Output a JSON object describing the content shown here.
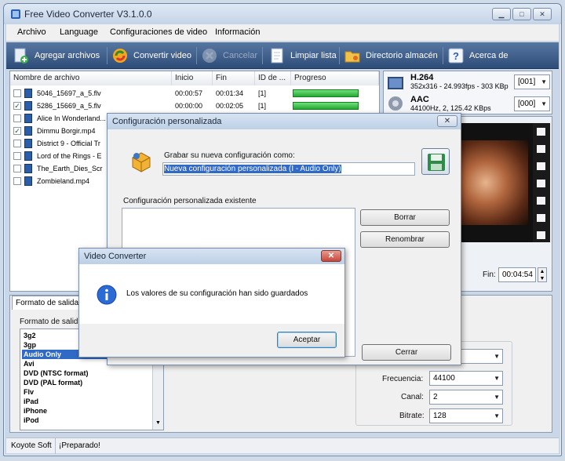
{
  "window": {
    "title": "Free Video Converter V3.1.0.0",
    "caption_buttons": [
      "minimize-icon",
      "maximize-icon",
      "close-icon"
    ]
  },
  "menu": {
    "items": [
      "Archivo",
      "Language",
      "Configuraciones de video",
      "Información"
    ]
  },
  "toolbar": {
    "buttons": [
      {
        "label": "Agregar archivos",
        "icon": "add-file-icon"
      },
      {
        "label": "Convertir video",
        "icon": "convert-icon"
      },
      {
        "label": "Cancelar",
        "icon": "cancel-icon"
      },
      {
        "label": "Limpiar lista",
        "icon": "clear-list-icon"
      },
      {
        "label": "Directorio almacén",
        "icon": "folder-icon"
      },
      {
        "label": "Acerca de",
        "icon": "help-icon"
      }
    ]
  },
  "file_table": {
    "columns": [
      "Nombre de archivo",
      "Inicio",
      "Fin",
      "ID de ...",
      "Progreso"
    ],
    "rows": [
      {
        "checked": false,
        "name": "5046_15697_a_5.flv",
        "start": "00:00:57",
        "end": "00:01:34",
        "id": "[1]",
        "progress": 1.0
      },
      {
        "checked": true,
        "name": "5286_15669_a_5.flv",
        "start": "00:00:00",
        "end": "00:02:05",
        "id": "[1]",
        "progress": 1.0
      },
      {
        "checked": false,
        "name": "Alice In Wonderland...",
        "start": "",
        "end": "",
        "id": "",
        "progress": 0
      },
      {
        "checked": true,
        "name": "Dimmu Borgir.mp4",
        "start": "",
        "end": "",
        "id": "",
        "progress": 0
      },
      {
        "checked": false,
        "name": "District 9 - Official Tr",
        "start": "",
        "end": "",
        "id": "",
        "progress": 0
      },
      {
        "checked": false,
        "name": "Lord of the Rings - E",
        "start": "",
        "end": "",
        "id": "",
        "progress": 0
      },
      {
        "checked": false,
        "name": "The_Earth_Dies_Scr",
        "start": "",
        "end": "",
        "id": "",
        "progress": 0
      },
      {
        "checked": false,
        "name": "Zombieland.mp4",
        "start": "",
        "end": "",
        "id": "",
        "progress": 0
      }
    ]
  },
  "streams": {
    "video": {
      "codec": "H.264",
      "details": "352x316 - 24.993fps - 303 KBp",
      "track": "[001]"
    },
    "audio": {
      "codec": "AAC",
      "details": "44100Hz, 2, 125.42 KBps",
      "track": "[000]"
    }
  },
  "fin": {
    "label": "Fin:",
    "value": "00:04:54"
  },
  "output_format": {
    "tab_label": "Formato de salida",
    "group_label": "Formato de salida",
    "items": [
      "3g2",
      "3gp",
      "Audio Only",
      "Avi",
      "DVD (NTSC format)",
      "DVD (PAL format)",
      "Flv",
      "iPad",
      "iPhone",
      "iPod"
    ],
    "selected": "Audio Only"
  },
  "audio_settings": {
    "frecuencia_label": "Frecuencia:",
    "frecuencia_value": "44100",
    "canal_label": "Canal:",
    "canal_value": "2",
    "bitrate_label": "Bitrate:",
    "bitrate_value": "128"
  },
  "custom_dialog": {
    "title": "Configuración personalizada",
    "save_as_label": "Grabar su nueva configuración como:",
    "save_as_value": "Nueva configuración personalizada (I - Audio Only)",
    "existing_label": "Configuración personalizada existente",
    "delete_button": "Borrar",
    "rename_button": "Renombrar",
    "close_button": "Cerrar"
  },
  "message_dialog": {
    "title": "Video Converter",
    "message": "Los valores de su configuración han sido guardados",
    "ok_button": "Aceptar"
  },
  "status": {
    "company": "Koyote Soft",
    "state": "¡Preparado!"
  }
}
